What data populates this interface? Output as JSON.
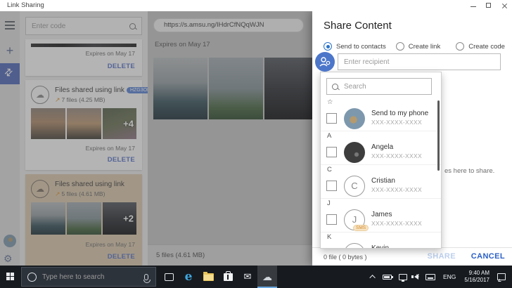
{
  "titlebar": {
    "title": "Link Sharing"
  },
  "icons": {
    "cloud": "☁",
    "gear": "⚙",
    "star": "☆",
    "arrow_up_right": "↗",
    "mail": "✉",
    "edge": "e",
    "share_link": "⇅",
    "plus": "+"
  },
  "left_panel": {
    "code_placeholder": "Enter code",
    "cards": [
      {
        "expires": "Expires on May 17",
        "delete_label": "DELETE"
      },
      {
        "title": "Files shared using link",
        "badge": "HZG3OD",
        "files_info": "7 files  (4.25 MB)",
        "more_overlay": "+4",
        "expires": "Expires on May 17",
        "delete_label": "DELETE"
      },
      {
        "title": "Files shared using link",
        "files_info": "5 files  (4.61 MB)",
        "more_overlay": "+2",
        "expires": "Expires on May 17",
        "delete_label": "DELETE"
      }
    ]
  },
  "middle_panel": {
    "url": "https://s.amsu.ng/IHdrCfNQqWJN",
    "expires": "Expires on May 17",
    "files_summary": "5 files  (4.61 MB)"
  },
  "share_panel": {
    "title": "Share Content",
    "options": [
      {
        "label": "Send to contacts"
      },
      {
        "label": "Create link"
      },
      {
        "label": "Create code"
      }
    ],
    "recipient_placeholder": "Enter recipient",
    "search_placeholder": "Search",
    "contacts": [
      {
        "section": "☆",
        "name": "Send to my phone",
        "number": "XXX-XXXX-XXXX"
      },
      {
        "section": "A",
        "name": "Angela",
        "number": "XXX-XXXX-XXXX"
      },
      {
        "section": "C",
        "name": "Cristian",
        "number": "XXX-XXXX-XXXX",
        "initial": "C"
      },
      {
        "section": "J",
        "name": "James",
        "number": "XXX-XXXX-XXXX",
        "initial": "J",
        "badge": "SMS"
      },
      {
        "section": "K",
        "name": "Kevin",
        "number": "",
        "initial": "K"
      }
    ],
    "background_text_fragment": "es here to share.",
    "footer": {
      "selection_info": "0 file ( 0 bytes )",
      "share_label": "SHARE",
      "cancel_label": "CANCEL"
    }
  },
  "taskbar": {
    "search_placeholder": "Type here to search",
    "language": "ENG",
    "time": "9:40 AM",
    "date": "5/16/2017"
  }
}
